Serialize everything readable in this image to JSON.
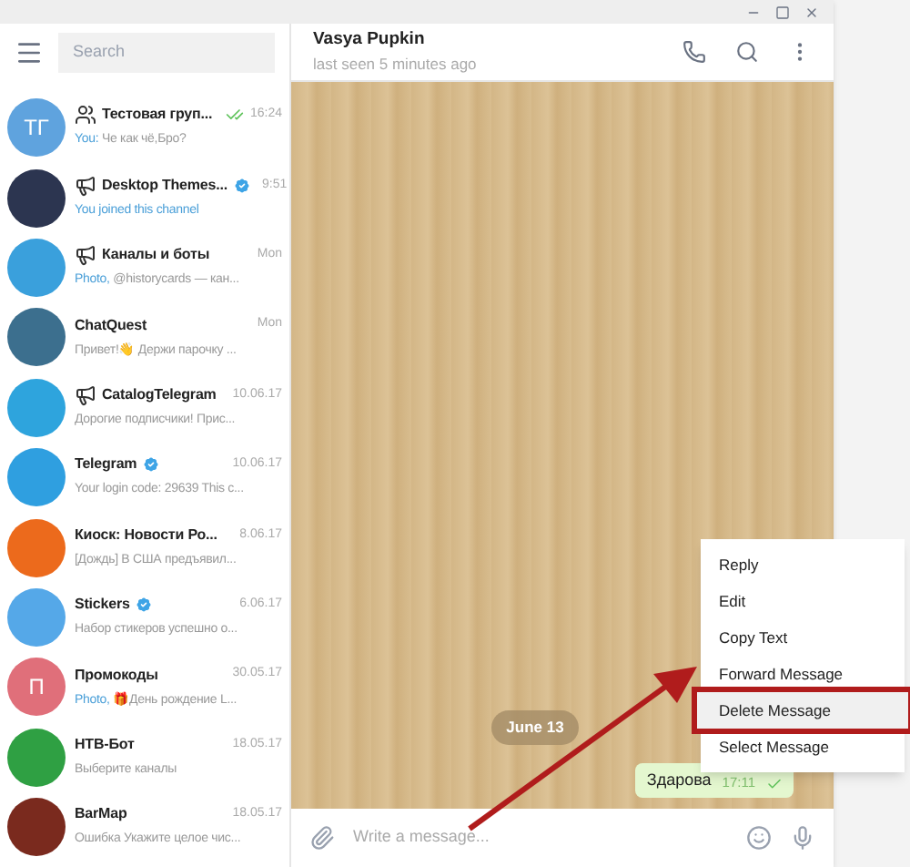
{
  "sidebar": {
    "search": {
      "placeholder": "Search"
    },
    "chats": [
      {
        "name": "Тестовая груп...",
        "kind": "group",
        "verified": false,
        "time": "16:24",
        "read": true,
        "prefix": "You:",
        "preview": " Че как чё,Бро?",
        "avatar": {
          "text": "ТГ",
          "color": "#5fa3de"
        }
      },
      {
        "name": "Desktop Themes...",
        "kind": "channel",
        "verified": true,
        "time": "9:51",
        "read": false,
        "prefix": "You joined this channel",
        "avatar": {
          "color": "#2c3550"
        }
      },
      {
        "name": "Каналы и боты",
        "kind": "channel",
        "verified": false,
        "time": "Mon",
        "read": false,
        "prefix": "Photo,",
        "preview": " @historycards — кан...",
        "avatar": {
          "color": "#3aa0dc"
        }
      },
      {
        "name": "ChatQuest",
        "kind": "user",
        "verified": false,
        "time": "Mon",
        "read": false,
        "preview": "Привет!👋 Держи парочку ...",
        "avatar": {
          "color": "#3c6f8e"
        }
      },
      {
        "name": "CatalogTelegram",
        "kind": "channel",
        "verified": false,
        "time": "10.06.17",
        "read": false,
        "preview": "Дорогие подписчики! Прис...",
        "avatar": {
          "color": "#2ea4dd"
        }
      },
      {
        "name": "Telegram",
        "kind": "user",
        "verified": true,
        "time": "10.06.17",
        "read": false,
        "preview": "Your login code: 29639  This c...",
        "avatar": {
          "color": "#2f9fe0"
        }
      },
      {
        "name": "Киоск: Новости Ро...",
        "kind": "user",
        "verified": false,
        "time": "8.06.17",
        "read": false,
        "preview": "[Дождь]  В США предъявил...",
        "avatar": {
          "color": "#ec6a1c"
        }
      },
      {
        "name": "Stickers",
        "kind": "user",
        "verified": true,
        "time": "6.06.17",
        "read": false,
        "preview": "Набор стикеров успешно о...",
        "avatar": {
          "color": "#55a8e8"
        }
      },
      {
        "name": "Промокоды",
        "kind": "user",
        "verified": false,
        "time": "30.05.17",
        "read": false,
        "prefix": "Photo,",
        "preview": " 🎁День рождение L...",
        "avatar": {
          "text": "П",
          "color": "#e06f7a"
        }
      },
      {
        "name": "НТВ-Бот",
        "kind": "user",
        "verified": false,
        "time": "18.05.17",
        "read": false,
        "preview": "Выберите каналы",
        "avatar": {
          "color": "#2fa043"
        }
      },
      {
        "name": "BarMap",
        "kind": "user",
        "verified": false,
        "time": "18.05.17",
        "read": false,
        "preview": "Ошибка Укажите целое чис...",
        "avatar": {
          "color": "#7a2a1e"
        }
      }
    ]
  },
  "chat": {
    "title": "Vasya Pupkin",
    "status": "last seen 5 minutes ago",
    "date": "June 13",
    "message": {
      "text": "Здарова",
      "time": "17:11",
      "sent": true
    },
    "input": {
      "placeholder": "Write a message..."
    }
  },
  "context_menu": [
    {
      "label": "Reply",
      "selected": false
    },
    {
      "label": "Edit",
      "selected": false
    },
    {
      "label": "Copy Text",
      "selected": false
    },
    {
      "label": "Forward Message",
      "selected": false
    },
    {
      "label": "Delete Message",
      "selected": true
    },
    {
      "label": "Select Message",
      "selected": false
    }
  ]
}
